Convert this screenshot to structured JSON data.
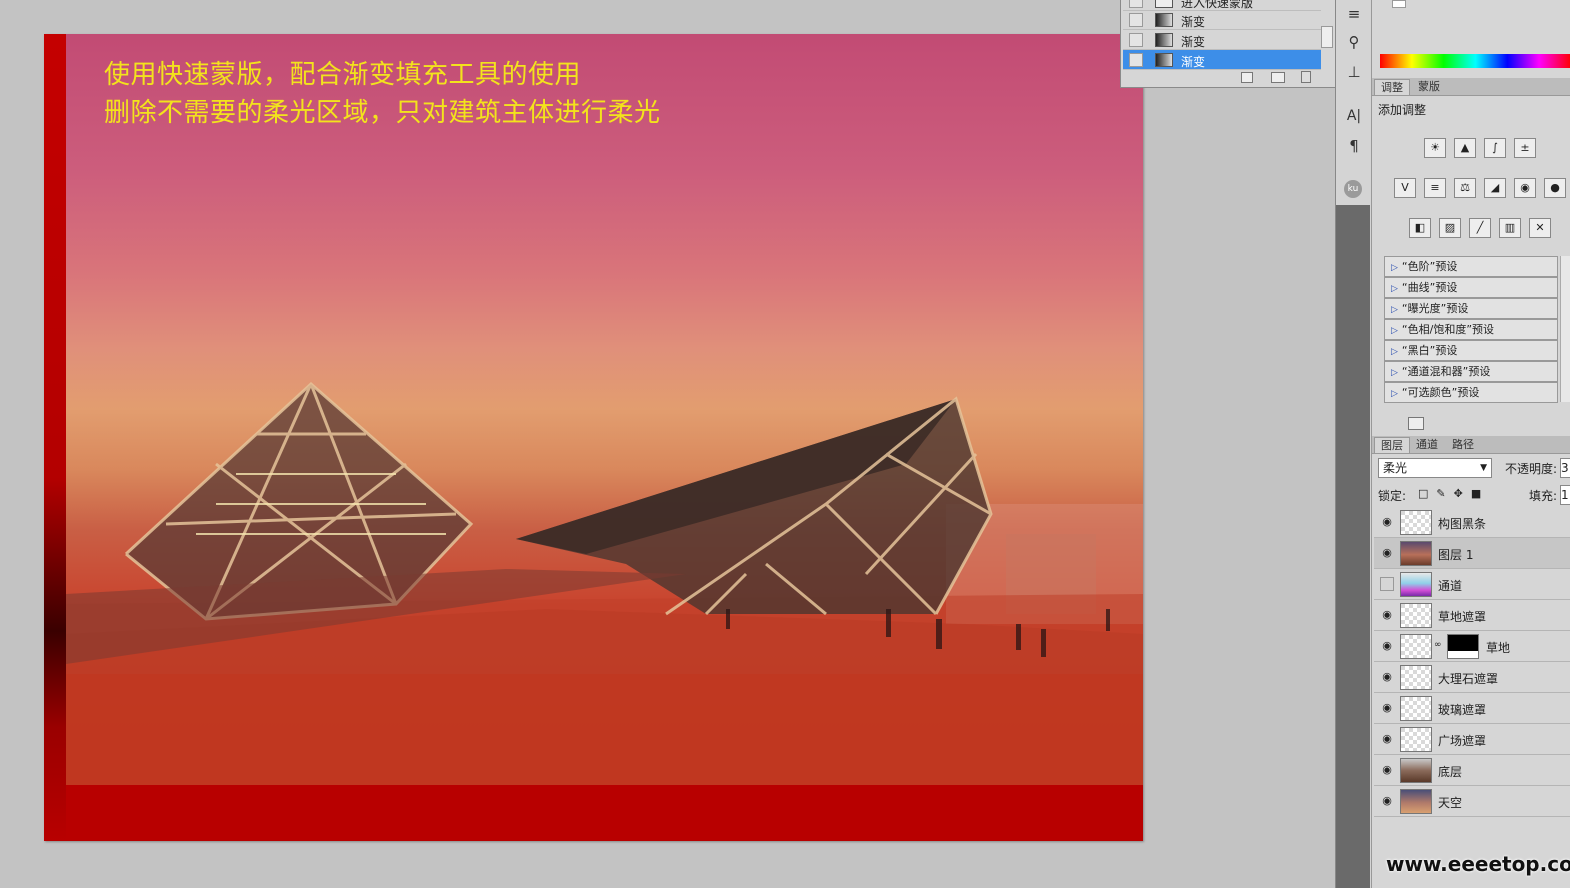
{
  "canvas": {
    "caption_line1": "使用快速蒙版，配合渐变填充工具的使用",
    "caption_line2": "删除不需要的柔光区域，只对建筑主体进行柔光",
    "accent_color": "#f3e31c",
    "frame_color": "#b80000"
  },
  "history_panel": {
    "items": [
      {
        "label": "进入快速蒙版",
        "selected": false
      },
      {
        "label": "渐变",
        "selected": false
      },
      {
        "label": "渐变",
        "selected": false
      },
      {
        "label": "渐变",
        "selected": true
      }
    ]
  },
  "tools": {
    "icons": [
      "brush-settings-icon",
      "clone-source-icon",
      "stamp-icon",
      "character-icon",
      "paragraph-icon",
      "kuler-icon"
    ],
    "char_glyph": "A|",
    "para_glyph": "¶",
    "kuler_glyph": "ku"
  },
  "adjustments_panel": {
    "tabs": [
      "调整",
      "蒙版"
    ],
    "title": "添加调整",
    "presets": [
      "“色阶”预设",
      "“曲线”预设",
      "“曝光度”预设",
      "“色相/饱和度”预设",
      "“黑白”预设",
      "“通道混和器”预设",
      "“可选颜色”预设"
    ]
  },
  "layers_panel": {
    "tabs": [
      "图层",
      "通道",
      "路径"
    ],
    "blend_mode": "柔光",
    "opacity_label": "不透明度:",
    "opacity_value": "3",
    "lock_label": "锁定:",
    "fill_label": "填充:",
    "fill_value": "1",
    "layers": [
      {
        "name": "构图黑条",
        "visible": true,
        "selected": false,
        "thumb": "transparent"
      },
      {
        "name": "图层 1",
        "visible": true,
        "selected": true,
        "thumb": "photo"
      },
      {
        "name": "通道",
        "visible": false,
        "selected": false,
        "thumb": "channel"
      },
      {
        "name": "草地遮罩",
        "visible": true,
        "selected": false,
        "thumb": "transparent"
      },
      {
        "name": "草地",
        "visible": true,
        "selected": false,
        "thumb": "photo-mask"
      },
      {
        "name": "大理石遮罩",
        "visible": true,
        "selected": false,
        "thumb": "transparent"
      },
      {
        "name": "玻璃遮罩",
        "visible": true,
        "selected": false,
        "thumb": "transparent"
      },
      {
        "name": "广场遮罩",
        "visible": true,
        "selected": false,
        "thumb": "transparent"
      },
      {
        "name": "底层",
        "visible": true,
        "selected": false,
        "thumb": "photo"
      },
      {
        "name": "天空",
        "visible": true,
        "selected": false,
        "thumb": "sky"
      }
    ]
  },
  "watermark": "www.eeeetop.com"
}
